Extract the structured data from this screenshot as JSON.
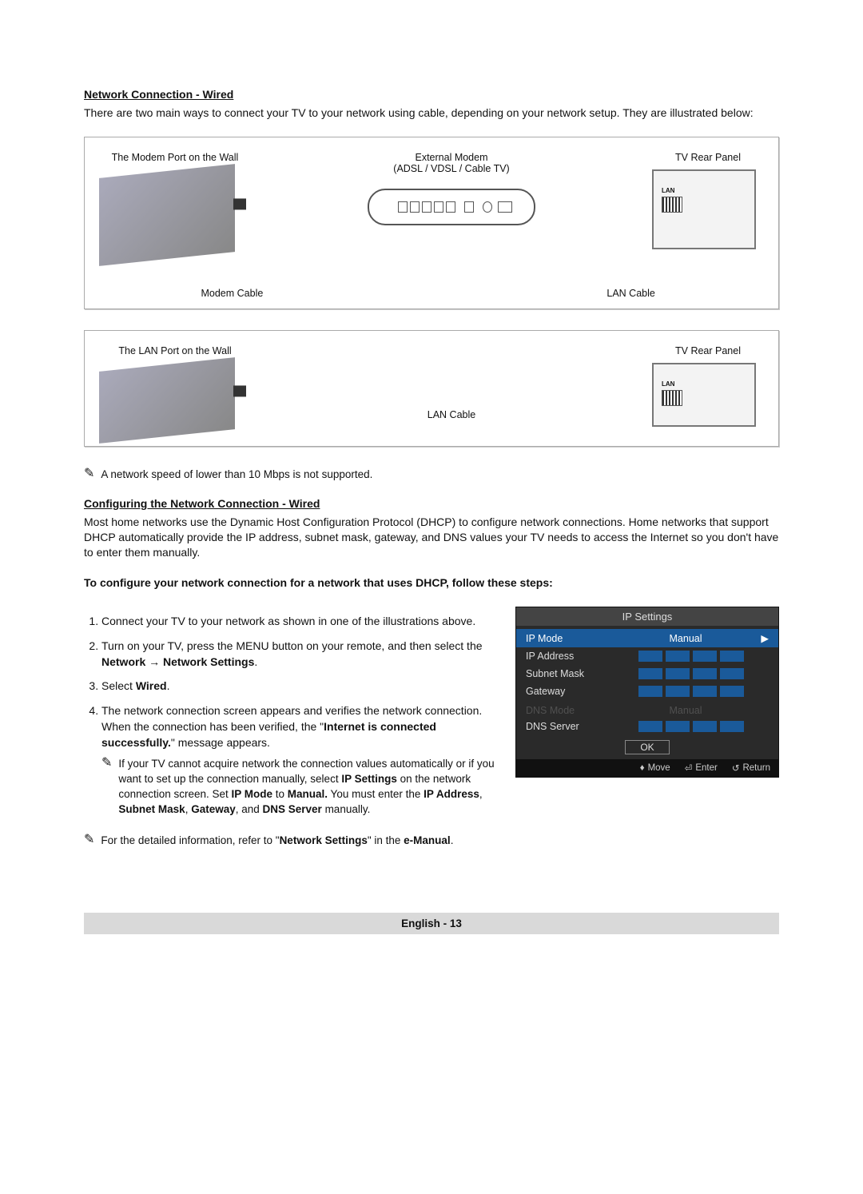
{
  "section1": {
    "heading": "Network Connection - Wired",
    "intro": "There are two main ways to connect your TV to your network using cable, depending on your network setup. They are illustrated below:"
  },
  "diagram1": {
    "wall_label": "The Modem Port on the Wall",
    "modem_label_top": "External Modem",
    "modem_label_sub": "(ADSL / VDSL / Cable TV)",
    "tv_label": "TV Rear Panel",
    "modem_cable": "Modem Cable",
    "lan_cable": "LAN Cable",
    "lan_text": "LAN"
  },
  "diagram2": {
    "wall_label": "The LAN Port on the Wall",
    "tv_label": "TV Rear Panel",
    "lan_cable": "LAN Cable",
    "lan_text": "LAN"
  },
  "note_speed": "A network speed of lower than 10 Mbps is not supported.",
  "section2": {
    "heading": "Configuring the Network Connection - Wired",
    "intro": "Most home networks use the Dynamic Host Configuration Protocol (DHCP) to configure network connections. Home networks that support DHCP automatically provide the IP address, subnet mask, gateway, and DNS values your TV needs to access the Internet so you don't have to enter them manually.",
    "bold_line": "To configure your network connection for a network that uses DHCP, follow these steps:"
  },
  "steps": {
    "s1": "Connect your TV to your network as shown in one of the illustrations above.",
    "s2a": "Turn on your TV, press the MENU button on your remote, and then select the ",
    "s2b": "Network → Network Settings",
    "s2c": ".",
    "s3a": "Select ",
    "s3b": "Wired",
    "s3c": ".",
    "s4a": "The network connection screen appears and verifies the network connection. When the connection has been verified, the \"",
    "s4b": "Internet is connected successfully.",
    "s4c": "\" message appears.",
    "subnote_a": "If your TV cannot acquire network the connection values automatically or if you want to set up the connection manually, select ",
    "subnote_b": "IP Settings",
    "subnote_c": " on the network connection screen. Set ",
    "subnote_d": "IP Mode",
    "subnote_e": " to ",
    "subnote_f": "Manual.",
    "subnote_g": " You must enter the ",
    "subnote_h": "IP Address",
    "subnote_i": ", ",
    "subnote_j": "Subnet Mask",
    "subnote_k": ", ",
    "subnote_l": "Gateway",
    "subnote_m": ", and ",
    "subnote_n": "DNS Server",
    "subnote_o": " manually."
  },
  "note_detail_a": "For the detailed information, refer to \"",
  "note_detail_b": "Network Settings",
  "note_detail_c": "\" in the ",
  "note_detail_d": "e-Manual",
  "note_detail_e": ".",
  "ip": {
    "title": "IP Settings",
    "ip_mode": "IP Mode",
    "ip_mode_val": "Manual",
    "ip_address": "IP Address",
    "subnet": "Subnet Mask",
    "gateway": "Gateway",
    "dns_mode": "DNS Mode",
    "dns_mode_val": "Manual",
    "dns_server": "DNS Server",
    "ok": "OK",
    "move": "Move",
    "enter": "Enter",
    "return": "Return"
  },
  "footer": "English - 13"
}
